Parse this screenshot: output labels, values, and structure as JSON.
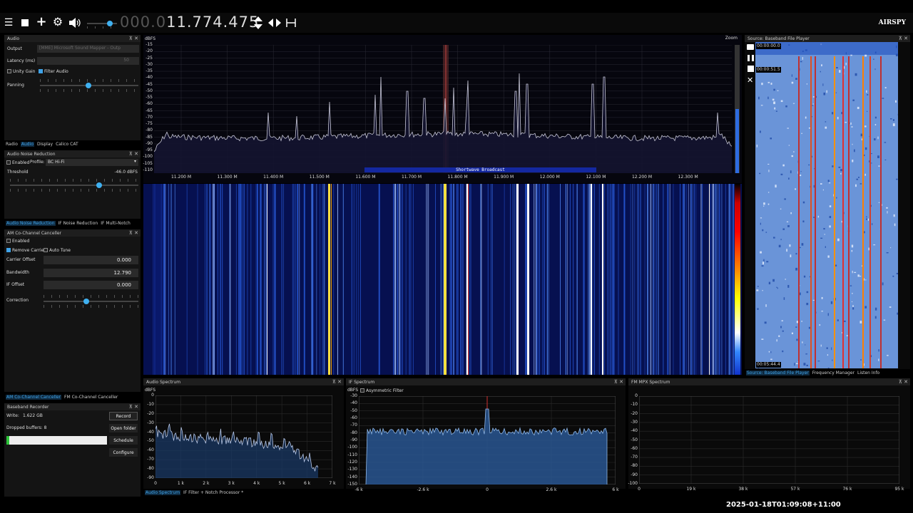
{
  "toolbar": {
    "freq_dim": "000.0",
    "freq_main": "11.774.475",
    "brand": "AIRSPY",
    "icons": [
      "menu-icon",
      "stop-icon",
      "plus-icon",
      "gear-icon",
      "speaker-icon",
      "updown-arrows-icon",
      "leftright-arrows-icon",
      "span-icon"
    ]
  },
  "audio": {
    "title": "Audio",
    "output_label": "Output",
    "output_value": "[MME] Microsoft Sound Mapper - Outp",
    "latency_label": "Latency (ms)",
    "latency_value": "50",
    "unity_gain": "Unity Gain",
    "filter_audio": "Filter Audio",
    "panning": "Panning",
    "panning_level": 0.5
  },
  "left_tabs": [
    "Radio",
    "Audio",
    "Display",
    "Calico CAT"
  ],
  "anr": {
    "title": "Audio Noise Reduction",
    "enabled": "Enabled",
    "profile_label": "Profile:",
    "profile_value": "BC Hi-Fi",
    "threshold_label": "Threshold",
    "threshold_value": "-46.0 dBFS",
    "threshold_level": 0.6
  },
  "nr_tabs": [
    "Audio Noise Reduction",
    "IF Noise Reduction",
    "IF Multi-Notch"
  ],
  "amcc": {
    "title": "AM Co-Channel Canceller",
    "enabled": "Enabled",
    "remove_carrier": "Remove Carrier",
    "auto_tune": "Auto Tune",
    "carrier_offset_label": "Carrier Offset",
    "carrier_offset": "0.000",
    "bandwidth_label": "Bandwidth",
    "bandwidth": "12.790",
    "if_offset_label": "IF Offset",
    "if_offset": "0.000",
    "correction_label": "Correction",
    "correction_level": 0.45
  },
  "cc_tabs": [
    "AM Co-Channel Canceller",
    "FM Co-Channel Canceller"
  ],
  "recorder": {
    "title": "Baseband Recorder",
    "write_label": "Write:",
    "write_value": "1.622 GB",
    "dropped_label": "Dropped buffers: 8",
    "record": "Record",
    "open_folder": "Open folder",
    "schedule": "Schedule",
    "configure": "Configure",
    "progress": 0.03
  },
  "spectrum": {
    "ylabel": "dBFS",
    "zoom": "Zoom",
    "yticks": [
      "-15",
      "-20",
      "-25",
      "-30",
      "-35",
      "-40",
      "-45",
      "-50",
      "-55",
      "-60",
      "-65",
      "-70",
      "-75",
      "-80",
      "-85",
      "-90",
      "-95",
      "-100",
      "-105",
      "-110"
    ],
    "xticks": [
      "11.200 M",
      "11.300 M",
      "11.400 M",
      "11.500 M",
      "11.600 M",
      "11.700 M",
      "11.800 M",
      "11.900 M",
      "12.000 M",
      "12.100 M",
      "12.200 M",
      "12.300 M"
    ],
    "band_label": "Shortwave Broadcast"
  },
  "source": {
    "title": "Source: Baseband File Player",
    "time_start": "00:00:00.0",
    "time_pos": "00:00:51.5",
    "time_end": "00:05:44.4"
  },
  "source_tabs": [
    "Source: Baseband File Player",
    "Frequency Manager",
    "Listen Info"
  ],
  "audio_spec": {
    "title": "Audio Spectrum",
    "ylabel": "dBFS",
    "yticks": [
      "0",
      "-10",
      "-20",
      "-30",
      "-40",
      "-50",
      "-60",
      "-70",
      "-80",
      "-90"
    ],
    "xticks": [
      "0",
      "1 k",
      "2 k",
      "3 k",
      "4 k",
      "5 k",
      "6 k",
      "7 k"
    ]
  },
  "bottom_tabs": [
    "Audio Spectrum",
    "IF Filter + Notch Processor *"
  ],
  "if_spec": {
    "title": "IF Spectrum",
    "ylabel": "dBFS",
    "asym": "Asymmetric Filter",
    "yticks": [
      "-30",
      "-40",
      "-50",
      "-60",
      "-70",
      "-80",
      "-90",
      "-100",
      "-110",
      "-120",
      "-130",
      "-140",
      "-150"
    ],
    "xticks": [
      "-6 k",
      "-2.6 k",
      "0",
      "2.6 k",
      "6 k"
    ]
  },
  "fm_spec": {
    "title": "FM MPX Spectrum",
    "yticks": [
      "0",
      "-10",
      "-20",
      "-30",
      "-40",
      "-50",
      "-60",
      "-70",
      "-80",
      "-90",
      "-100"
    ],
    "xticks": [
      "0",
      "19 k",
      "38 k",
      "57 k",
      "76 k",
      "95 k"
    ]
  },
  "timestamp": "2025-01-18T01:09:08+11:00"
}
